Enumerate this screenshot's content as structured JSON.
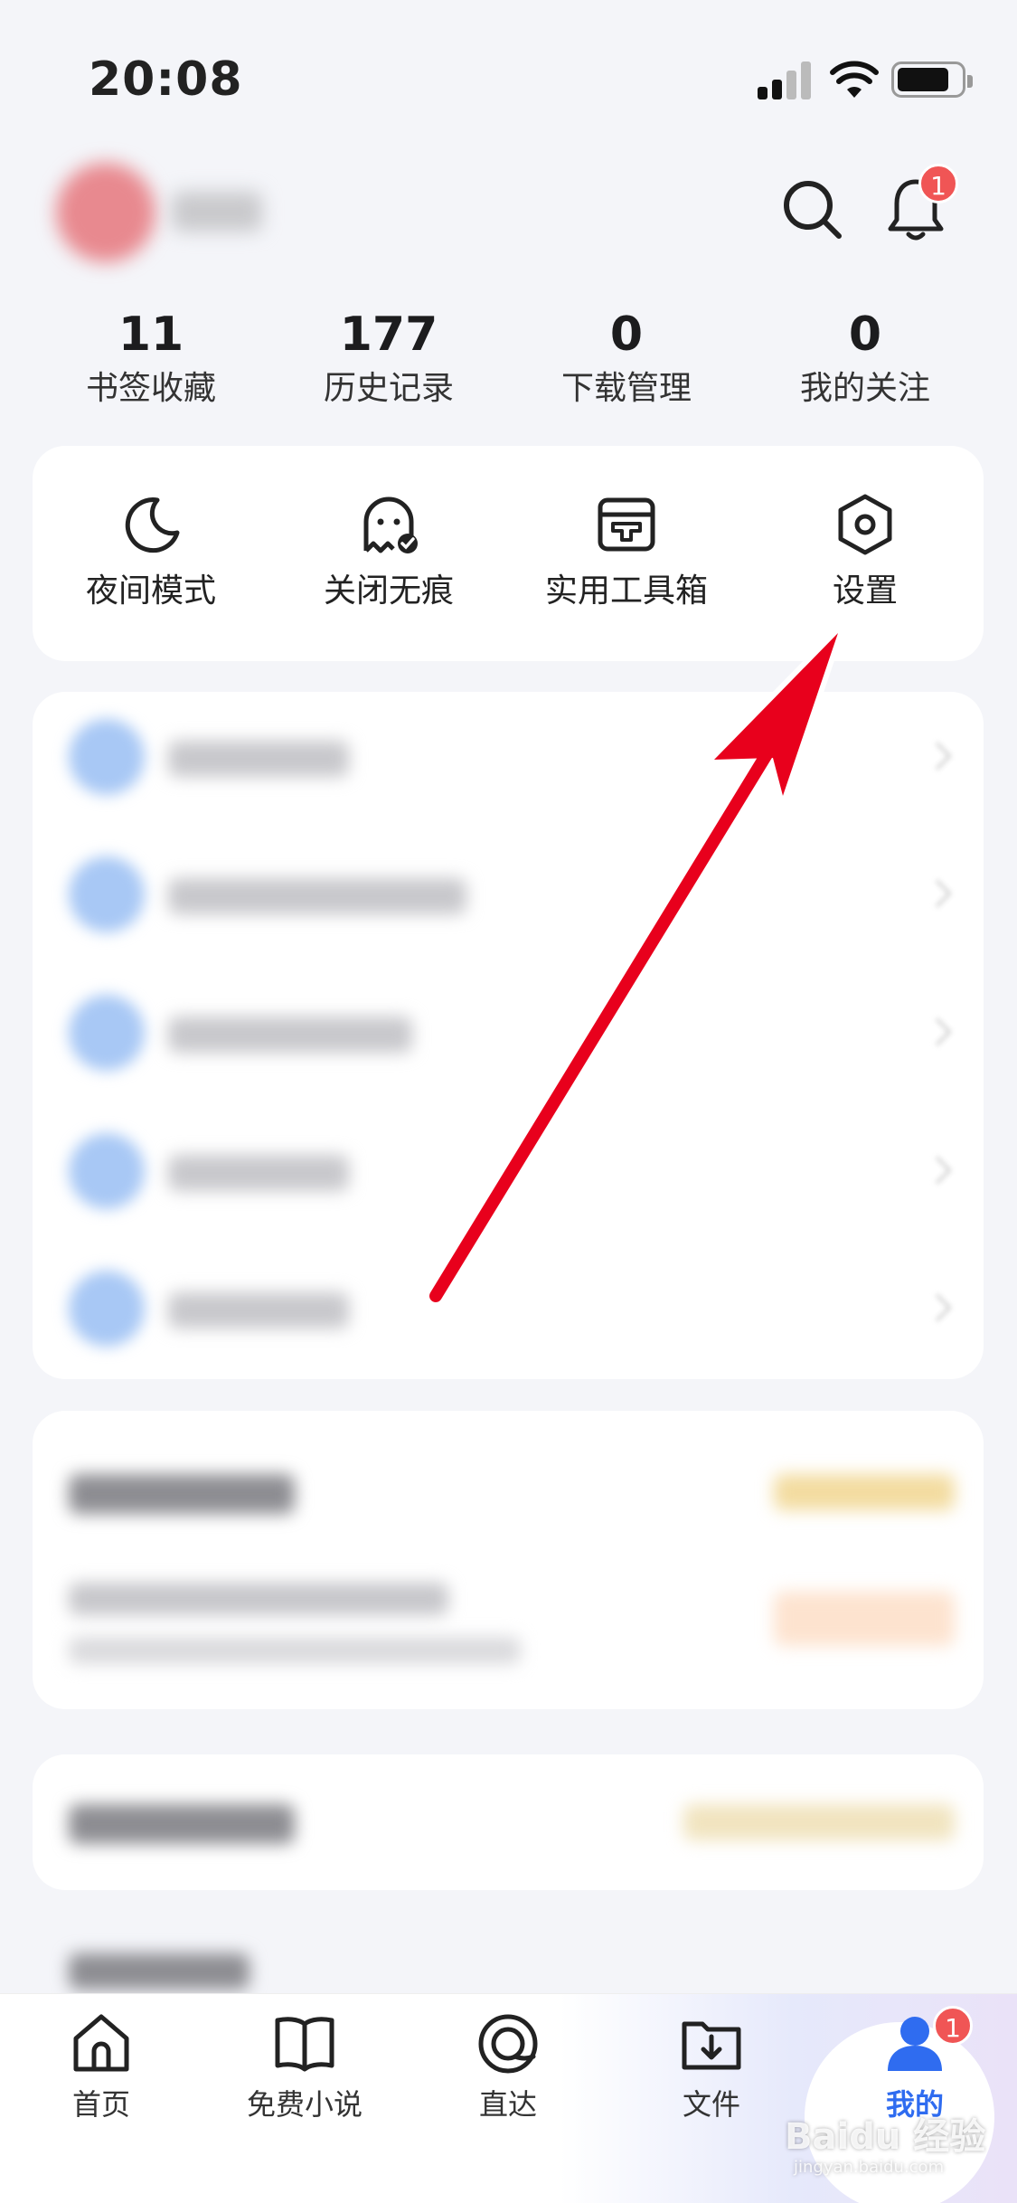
{
  "status_bar": {
    "time": "20:08"
  },
  "header": {
    "notification_badge": "1"
  },
  "stats": [
    {
      "value": "11",
      "label": "书签收藏"
    },
    {
      "value": "177",
      "label": "历史记录"
    },
    {
      "value": "0",
      "label": "下载管理"
    },
    {
      "value": "0",
      "label": "我的关注"
    }
  ],
  "tools": [
    {
      "label": "夜间模式",
      "icon": "moon-icon"
    },
    {
      "label": "关闭无痕",
      "icon": "ghost-icon"
    },
    {
      "label": "实用工具箱",
      "icon": "toolbox-icon"
    },
    {
      "label": "设置",
      "icon": "hexagon-settings-icon"
    }
  ],
  "tabbar": {
    "tabs": [
      {
        "label": "首页",
        "icon": "home-icon"
      },
      {
        "label": "免费小说",
        "icon": "book-icon"
      },
      {
        "label": "直达",
        "icon": "direct-icon"
      },
      {
        "label": "文件",
        "icon": "folder-download-icon"
      },
      {
        "label": "我的",
        "icon": "user-icon"
      }
    ],
    "active_tab": "我的",
    "me_badge": "1"
  },
  "watermark": {
    "brand": "Baidu 经验",
    "url": "jingyan.baidu.com"
  },
  "colors": {
    "accent": "#2f6cf0",
    "badge": "#f05555",
    "arrow": "#e8001c"
  }
}
